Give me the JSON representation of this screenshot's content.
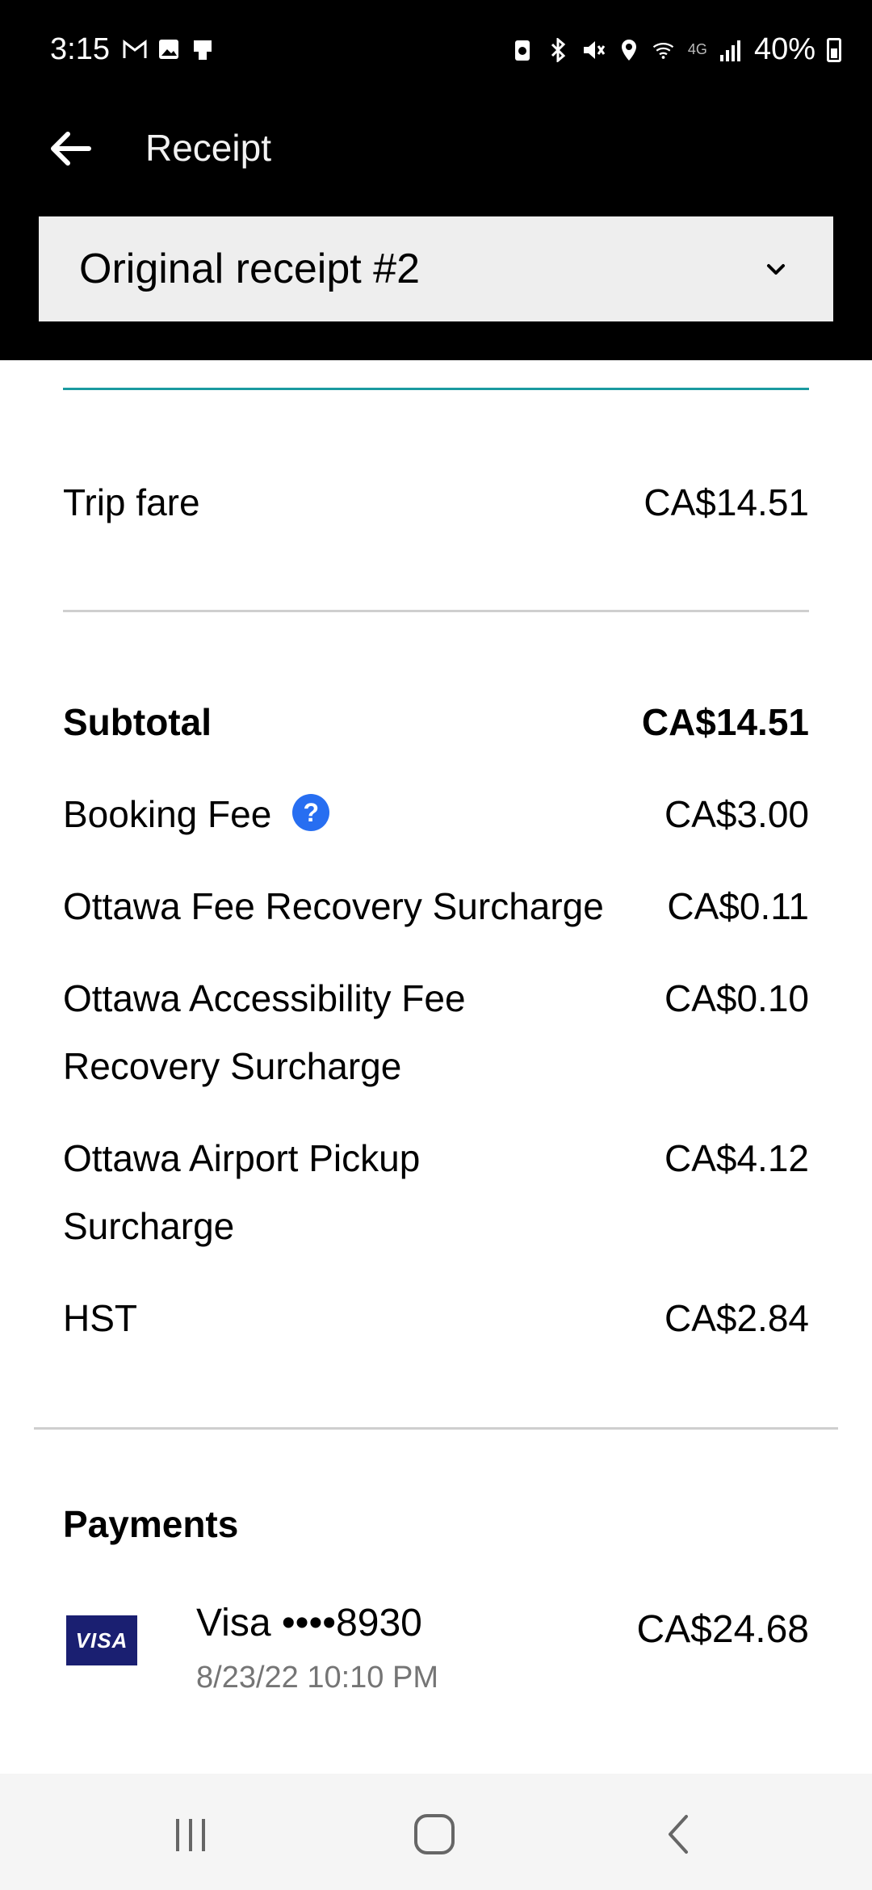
{
  "status_bar": {
    "time": "3:15",
    "battery": "40%",
    "network": "4G"
  },
  "app_bar": {
    "title": "Receipt"
  },
  "receipt_select": {
    "selected": "Original receipt #2"
  },
  "fare": {
    "label": "Trip fare",
    "amount": "CA$14.51"
  },
  "breakdown": {
    "subtotal": {
      "label": "Subtotal",
      "amount": "CA$14.51"
    },
    "booking_fee": {
      "label": "Booking Fee",
      "amount": "CA$3.00",
      "help": "?"
    },
    "fee_recovery": {
      "label": "Ottawa Fee Recovery Surcharge",
      "amount": "CA$0.11"
    },
    "accessibility": {
      "label_line1": "Ottawa Accessibility Fee",
      "label_line2": "Recovery Surcharge",
      "amount": "CA$0.10"
    },
    "airport": {
      "label_line1": "Ottawa Airport Pickup",
      "label_line2": "Surcharge",
      "amount": "CA$4.12"
    },
    "hst": {
      "label": "HST",
      "amount": "CA$2.84"
    }
  },
  "payments": {
    "title": "Payments",
    "card_brand": "VISA",
    "card_name": "Visa ••••8930",
    "date": "8/23/22 10:10 PM",
    "amount": "CA$24.68"
  },
  "colors": {
    "accent_teal": "#1a9aa0",
    "help_blue": "#276ef1",
    "visa_blue": "#1a1f71"
  }
}
